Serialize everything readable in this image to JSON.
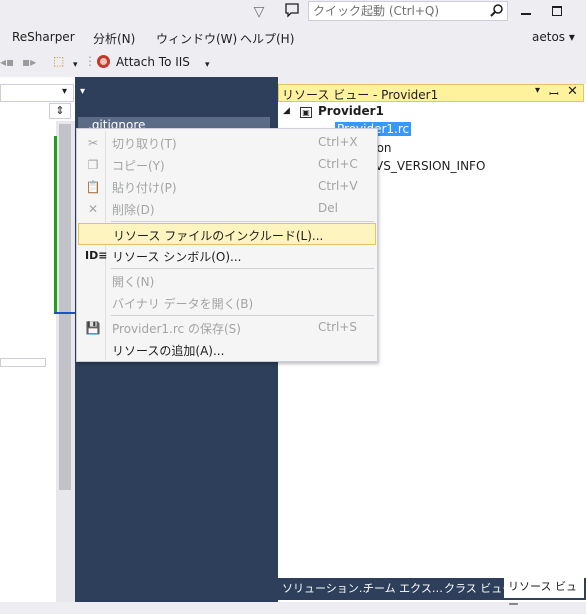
{
  "titlebar": {
    "quick_launch_placeholder": "クイック起動 (Ctrl+Q)"
  },
  "menubar": {
    "items": [
      "ReSharper",
      "分析(N)",
      "ウィンドウ(W)",
      "ヘルプ(H)"
    ],
    "account": "aetos ▾"
  },
  "toolbar": {
    "attach_label": "Attach To IIS"
  },
  "editor": {
    "tab_label": ".gitignore"
  },
  "resource_view": {
    "title": "リソース ビュー - Provider1",
    "tree": {
      "root": "Provider1",
      "rc_file": "Provider1.rc",
      "version": "sion",
      "vs_info": "VS_VERSION_INFO"
    }
  },
  "bottom_tabs": {
    "items": [
      "ソリューション…",
      "チーム エクス…",
      "クラス ビュー"
    ],
    "active": "リソース ビュー"
  },
  "context_menu": {
    "items": [
      {
        "label": "切り取り(T)",
        "shortcut": "Ctrl+X",
        "icon": "cut-icon",
        "enabled": false
      },
      {
        "label": "コピー(Y)",
        "shortcut": "Ctrl+C",
        "icon": "copy-icon",
        "enabled": false
      },
      {
        "label": "貼り付け(P)",
        "shortcut": "Ctrl+V",
        "icon": "paste-icon",
        "enabled": false
      },
      {
        "label": "削除(D)",
        "shortcut": "Del",
        "icon": "delete-icon",
        "enabled": false
      },
      {
        "label": "リソース ファイルのインクルード(L)...",
        "shortcut": "",
        "icon": "",
        "enabled": true,
        "highlighted": true
      },
      {
        "label": "リソース シンボル(O)...",
        "shortcut": "",
        "icon": "id-icon",
        "enabled": true
      },
      {
        "label": "開く(N)",
        "shortcut": "",
        "icon": "",
        "enabled": false
      },
      {
        "label": "バイナリ データを開く(B)",
        "shortcut": "",
        "icon": "",
        "enabled": false
      },
      {
        "label": "Provider1.rc の保存(S)",
        "shortcut": "Ctrl+S",
        "icon": "save-icon",
        "enabled": false
      },
      {
        "label": "リソースの追加(A)...",
        "shortcut": "",
        "icon": "",
        "enabled": true
      }
    ]
  }
}
